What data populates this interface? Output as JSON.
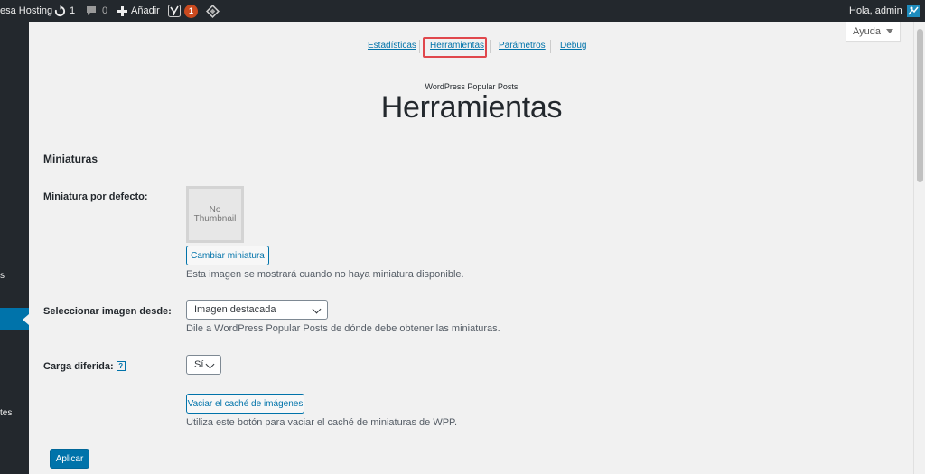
{
  "adminbar": {
    "site_name": "esa Hosting",
    "updates_count": "1",
    "comments_count": "0",
    "add_new_label": "Añadir",
    "yoast_badge": "1",
    "greeting": "Hola, admin"
  },
  "sidebar": {
    "fragment_1": "s",
    "fragment_2": "tes"
  },
  "help_tab": {
    "label": "Ayuda"
  },
  "tabs": [
    {
      "label": "Estadísticas"
    },
    {
      "label": "Herramientas"
    },
    {
      "label": "Parámetros"
    },
    {
      "label": "Debug"
    }
  ],
  "header": {
    "plugin_name": "WordPress Popular Posts",
    "page_title": "Herramientas"
  },
  "section": {
    "title": "Miniaturas"
  },
  "thumbnail": {
    "label": "Miniatura por defecto:",
    "placeholder_line1": "No",
    "placeholder_line2": "Thumbnail",
    "change_button": "Cambiar miniatura",
    "description": "Esta imagen se mostrará cuando no haya miniatura disponible."
  },
  "image_source": {
    "label": "Seleccionar imagen desde:",
    "selected": "Imagen destacada",
    "description": "Dile a WordPress Popular Posts de dónde debe obtener las miniaturas."
  },
  "lazy_load": {
    "label": "Carga diferida:",
    "help": "?",
    "selected": "Sí"
  },
  "cache": {
    "button": "Vaciar el caché de imágenes",
    "description": "Utiliza este botón para vaciar el caché de miniaturas de WPP."
  },
  "apply_button": "Aplicar",
  "colors": {
    "admin_bar": "#23282d",
    "accent": "#0073aa",
    "badge": "#ca4a1f",
    "highlight": "#e0474c"
  }
}
